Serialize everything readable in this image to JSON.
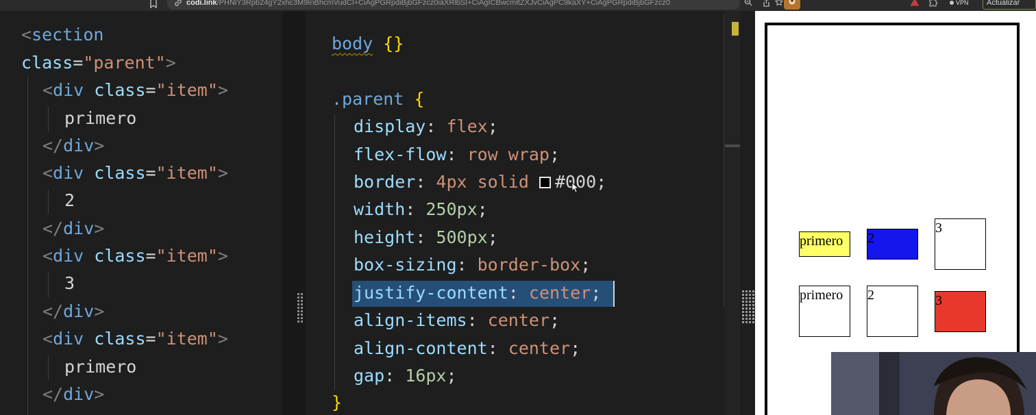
{
  "browser": {
    "url_host": "codi.link",
    "url_path": "/PHNlY3Rpb24gY2xhc3M9InBhcmVudCI+CiAgPGRpdiBjbGFzcz0iaXRlbSI+CiAgICBwcmltZXJvCiAgPC9kaXY+CiAgPGRpdiBjbGFzcz0",
    "vpn_label": "VPN",
    "update_label": "Actualizar",
    "icons": [
      "bookmark-icon",
      "link-icon",
      "zoom-icon",
      "share-icon",
      "star-icon",
      "extension-avatar-icon",
      "alert-icon",
      "puzzle-icon"
    ],
    "accent_colors": {
      "alert": "#c43d3d",
      "update_border": "#6e8b4e",
      "extension": "#b5732e"
    }
  },
  "html_editor": {
    "lines": [
      {
        "tag_open": "<",
        "name": "section",
        "rest": ""
      },
      {
        "attr": "class",
        "eq": "=",
        "str": "\"parent\"",
        "tag_close": ">"
      },
      {
        "tag_open": "<",
        "name": "div",
        "attr": " class",
        "eq": "=",
        "str": "\"item\"",
        "tag_close": ">"
      },
      {
        "text": "primero"
      },
      {
        "tag_open": "</",
        "name": "div",
        "tag_close": ">"
      },
      {
        "tag_open": "<",
        "name": "div",
        "attr": " class",
        "eq": "=",
        "str": "\"item\"",
        "tag_close": ">"
      },
      {
        "text": "2"
      },
      {
        "tag_open": "</",
        "name": "div",
        "tag_close": ">"
      },
      {
        "tag_open": "<",
        "name": "div",
        "attr": " class",
        "eq": "=",
        "str": "\"item\"",
        "tag_close": ">"
      },
      {
        "text": "3"
      },
      {
        "tag_open": "</",
        "name": "div",
        "tag_close": ">"
      },
      {
        "tag_open": "<",
        "name": "div",
        "attr": " class",
        "eq": "=",
        "str": "\"item\"",
        "tag_close": ">"
      },
      {
        "text": "primero"
      },
      {
        "tag_open": "</",
        "name": "div",
        "tag_close": ">"
      }
    ]
  },
  "css_editor": {
    "body_selector": "body",
    "body_braces": "{}",
    "parent_selector": ".parent",
    "open_brace": "{",
    "close_brace": "}",
    "declarations": [
      {
        "prop": "display",
        "value": "flex"
      },
      {
        "prop": "flex-flow",
        "value": "row wrap"
      },
      {
        "prop": "border",
        "value": "4px solid",
        "value2": "#000"
      },
      {
        "prop": "width",
        "value": "250px"
      },
      {
        "prop": "height",
        "value": "500px"
      },
      {
        "prop": "box-sizing",
        "value": "border-box"
      },
      {
        "prop": "justify-content",
        "value": "center"
      },
      {
        "prop": "align-items",
        "value": "center"
      },
      {
        "prop": "align-content",
        "value": "center"
      },
      {
        "prop": "gap",
        "value": "16px"
      }
    ],
    "selected_declaration": "justify-content: center;"
  },
  "preview": {
    "items": [
      {
        "label": "primero",
        "bg": "#ffff66"
      },
      {
        "label": "2",
        "bg": "#1515ee"
      },
      {
        "label": "3",
        "bg": "#ffffff"
      },
      {
        "label": "primero",
        "bg": "#ffffff"
      },
      {
        "label": "2",
        "bg": "#ffffff"
      },
      {
        "label": "3",
        "bg": "#e8382c"
      }
    ]
  }
}
